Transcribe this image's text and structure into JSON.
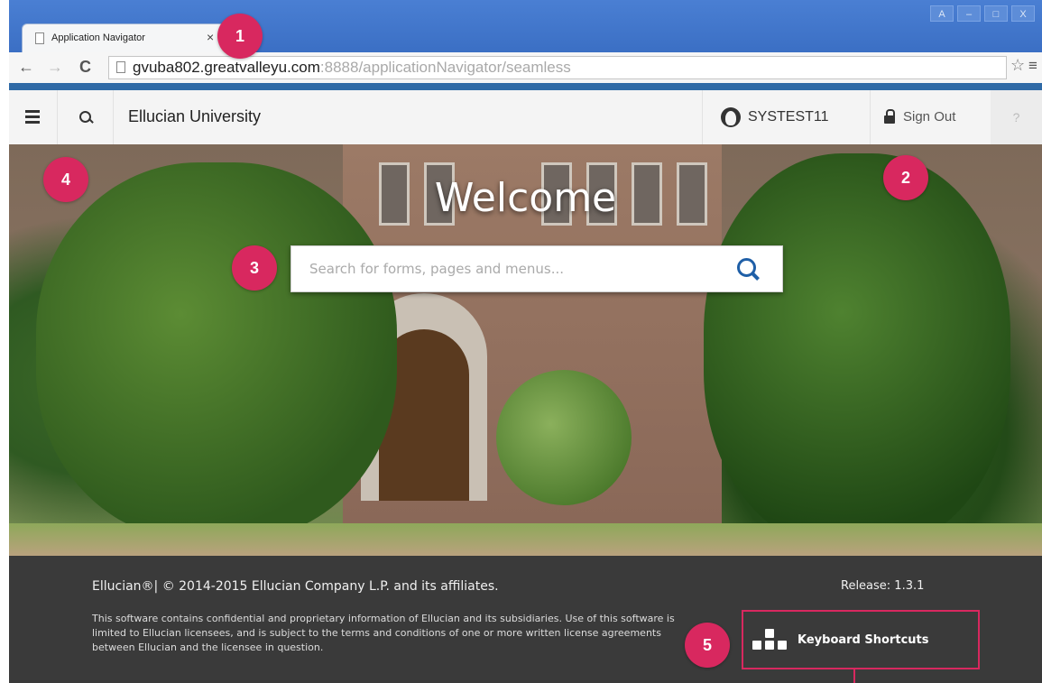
{
  "browser": {
    "tab_title": "Application Navigator",
    "tab_close": "×",
    "url_host": "gvuba802.greatvalleyu.com",
    "url_path": ":8888/applicationNavigator/seamless",
    "back": "←",
    "forward": "→",
    "reload": "C",
    "star": "☆",
    "menu": "≡",
    "window_controls": [
      "A",
      "–",
      "□",
      "X"
    ]
  },
  "header": {
    "app_title": "Ellucian University",
    "username": "SYSTEST11",
    "sign_out": "Sign Out",
    "help": "?"
  },
  "hero": {
    "welcome": "Welcome",
    "search_placeholder": "Search for forms, pages and menus..."
  },
  "footer": {
    "copyright": "Ellucian®| © 2014-2015 Ellucian Company L.P. and its affiliates.",
    "release": "Release: 1.3.1",
    "legal": "This software contains confidential and proprietary information of Ellucian and its subsidiaries. Use of this software is limited to Ellucian licensees, and is subject to the terms and conditions of one or more written license agreements between Ellucian and the licensee in question.",
    "keyboard_shortcuts": "Keyboard Shortcuts"
  },
  "callouts": [
    "1",
    "2",
    "3",
    "4",
    "5"
  ],
  "colors": {
    "callout": "#d8285f",
    "footer_bg": "#3a3a3a",
    "header_bg": "#f4f4f4",
    "accent_blue": "#1f5fa7",
    "chrome_blue": "#3b6fc4"
  },
  "icons": [
    "document-icon",
    "close-icon",
    "back-arrow-icon",
    "forward-arrow-icon",
    "reload-icon",
    "bookmark-star-icon",
    "browser-menu-icon",
    "hamburger-menu-icon",
    "search-icon",
    "user-avatar-icon",
    "lock-icon",
    "help-icon",
    "keyboard-icon"
  ]
}
